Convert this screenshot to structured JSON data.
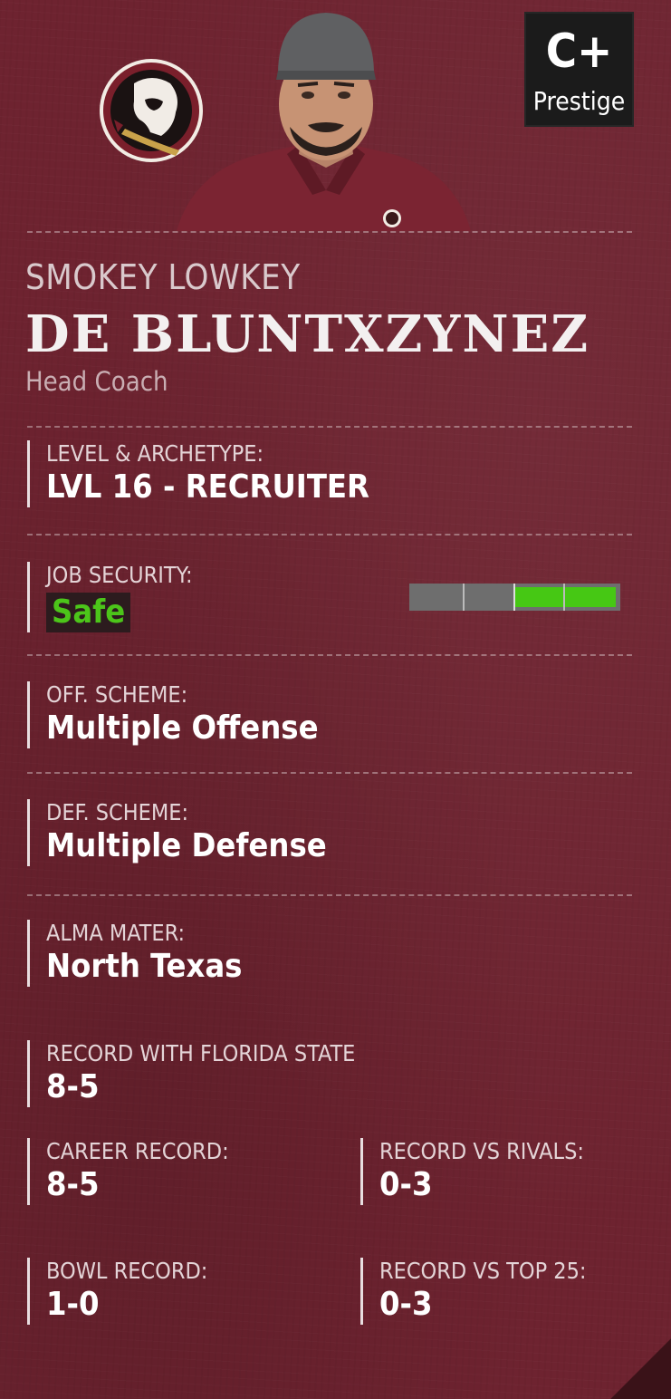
{
  "header": {
    "prestige_grade": "C+",
    "prestige_label": "Prestige",
    "logo_icon": "seminole-head-logo-icon",
    "portrait_icon": "coach-portrait"
  },
  "coach": {
    "first_name": "SMOKEY LOWKEY",
    "last_name": "DE BLUNTXZYNEZ",
    "role": "Head Coach"
  },
  "level": {
    "label": "LEVEL & ARCHETYPE:",
    "value": "LVL 16 - RECRUITER"
  },
  "job_security": {
    "label": "JOB SECURITY:",
    "value": "Safe",
    "meter_start": 0.5,
    "meter_end": 0.98,
    "color": "#46c814"
  },
  "off_scheme": {
    "label": "OFF. SCHEME:",
    "value": "Multiple Offense"
  },
  "def_scheme": {
    "label": "DEF. SCHEME:",
    "value": "Multiple Defense"
  },
  "alma_mater": {
    "label": "ALMA MATER:",
    "value": "North Texas"
  },
  "record_team": {
    "label": "RECORD WITH FLORIDA STATE",
    "value": "8-5"
  },
  "career_record": {
    "label": "CAREER RECORD:",
    "value": "8-5"
  },
  "rivals_record": {
    "label": "RECORD VS RIVALS:",
    "value": "0-3"
  },
  "bowl_record": {
    "label": "BOWL RECORD:",
    "value": "1-0"
  },
  "top25_record": {
    "label": "RECORD VS TOP 25:",
    "value": "0-3"
  },
  "colors": {
    "background": "#6e2330",
    "accent_green": "#46c814",
    "gold": "#c9a24a"
  }
}
